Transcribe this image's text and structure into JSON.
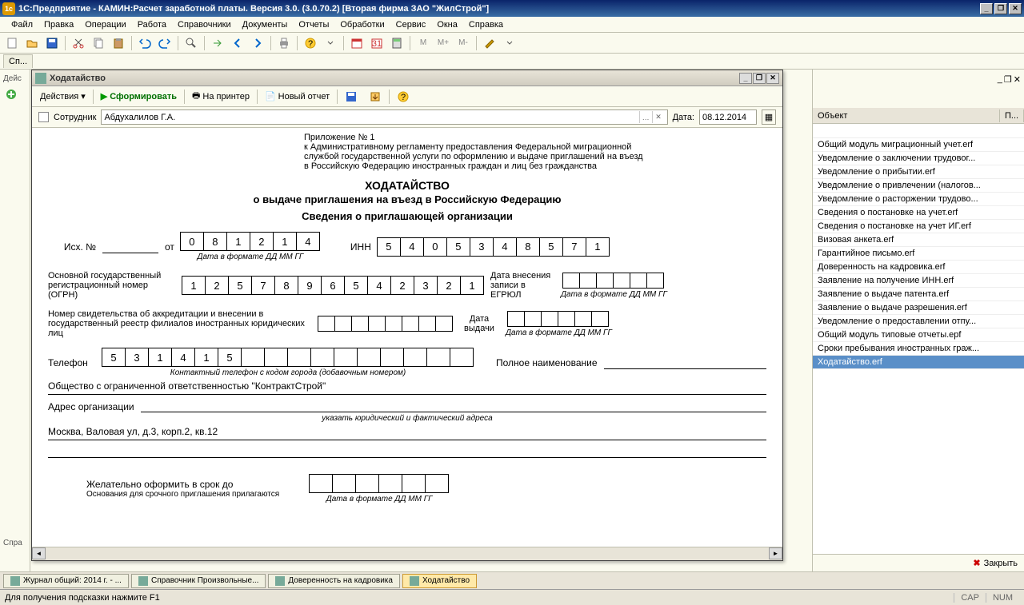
{
  "title": "1С:Предприятие - КАМИН:Расчет заработной платы.  Версия 3.0. (3.0.70.2) [Вторая фирма ЗАО \"ЖилСтрой\"]",
  "menu": [
    "Файл",
    "Правка",
    "Операции",
    "Работа",
    "Справочники",
    "Документы",
    "Отчеты",
    "Обработки",
    "Сервис",
    "Окна",
    "Справка"
  ],
  "mdi_tab": "Сп...",
  "left_label": "Дейс",
  "dialog": {
    "title": "Ходатайство",
    "toolbar": {
      "actions": "Действия",
      "form": "Сформировать",
      "print": "На принтер",
      "new_report": "Новый отчет"
    },
    "params": {
      "emp_label": "Сотрудник",
      "emp_value": "Абдухалилов Г.А.",
      "date_label": "Дата:",
      "date_value": "08.12.2014"
    }
  },
  "doc": {
    "attach": [
      "Приложение № 1",
      "к Административному регламенту предоставления Федеральной миграционной",
      "службой государственной услуги по оформлению и выдаче приглашений на въезд",
      "в Российскую Федерацию иностранных граждан и лиц без гражданства"
    ],
    "h1": "ХОДАТАЙСТВО",
    "h2": "о выдаче приглашения на въезд в Российскую Федерацию",
    "h3": "Сведения о приглашающей организации",
    "ish": "Исх. №",
    "ot": "от",
    "date_cells": [
      "0",
      "8",
      "1",
      "2",
      "1",
      "4"
    ],
    "date_hint": "Дата в формате ДД ММ ГГ",
    "inn_label": "ИНН",
    "inn": [
      "5",
      "4",
      "0",
      "5",
      "3",
      "4",
      "8",
      "5",
      "7",
      "1"
    ],
    "ogrn_label": "Основной государственный регистрационный номер (ОГРН)",
    "ogrn": [
      "1",
      "2",
      "5",
      "7",
      "8",
      "9",
      "6",
      "5",
      "4",
      "2",
      "3",
      "2",
      "1"
    ],
    "egrul_label": "Дата внесения записи в ЕГРЮЛ",
    "accred_label": "Номер свидетельства об аккредитации и внесении в государственный реестр филиалов иностранных юридических лиц",
    "issue_label": "Дата выдачи",
    "phone_label": "Телефон",
    "phone": [
      "5",
      "3",
      "1",
      "4",
      "1",
      "5",
      "",
      "",
      "",
      "",
      "",
      "",
      "",
      "",
      "",
      ""
    ],
    "phone_hint": "Контактный телефон с кодом города (добавочным номером)",
    "fullname_label": "Полное наименование",
    "org_name": "Общество с ограниченной ответственностью \"КонтрактСтрой\"",
    "addr_label": "Адрес организации",
    "addr_hint": "указать  юридический и фактический адреса",
    "addr_value": "Москва, Валовая ул, д.3, корп.2, кв.12",
    "wish_label": "Желательно оформить в срок до",
    "reason_label": "Основания для срочного приглашения прилагаются"
  },
  "right": {
    "col_object": "Объект",
    "col_p": "П...",
    "items": [
      "Общий модуль миграционный учет.erf",
      "Уведомление о заключении трудовог...",
      "Уведомление о прибытии.erf",
      "Уведомление о привлечении (налогов...",
      "Уведомление о расторжении трудово...",
      "Сведения о постановке на учет.erf",
      "Сведения о постановке на учет ИГ.erf",
      "Визовая анкета.erf",
      "Гарантийное письмо.erf",
      "Доверенность на кадровика.erf",
      "Заявление на получение ИНН.erf",
      "Заявление о выдаче патента.erf",
      "Заявление о выдаче разрешения.erf",
      "Уведомление о предоставлении отпу...",
      "Общий модуль типовые отчеты.epf",
      "Сроки пребывания иностранных граж...",
      "Ходатайство.erf"
    ],
    "selected": 16,
    "close": "Закрыть"
  },
  "tasks": [
    "Журнал общий: 2014 г. - ...",
    "Справочник Произвольные...",
    "Доверенность на кадровика",
    "Ходатайство"
  ],
  "task_active": 3,
  "status": {
    "hint": "Для получения подсказки нажмите F1",
    "cap": "CAP",
    "num": "NUM"
  },
  "spra": "Спра"
}
